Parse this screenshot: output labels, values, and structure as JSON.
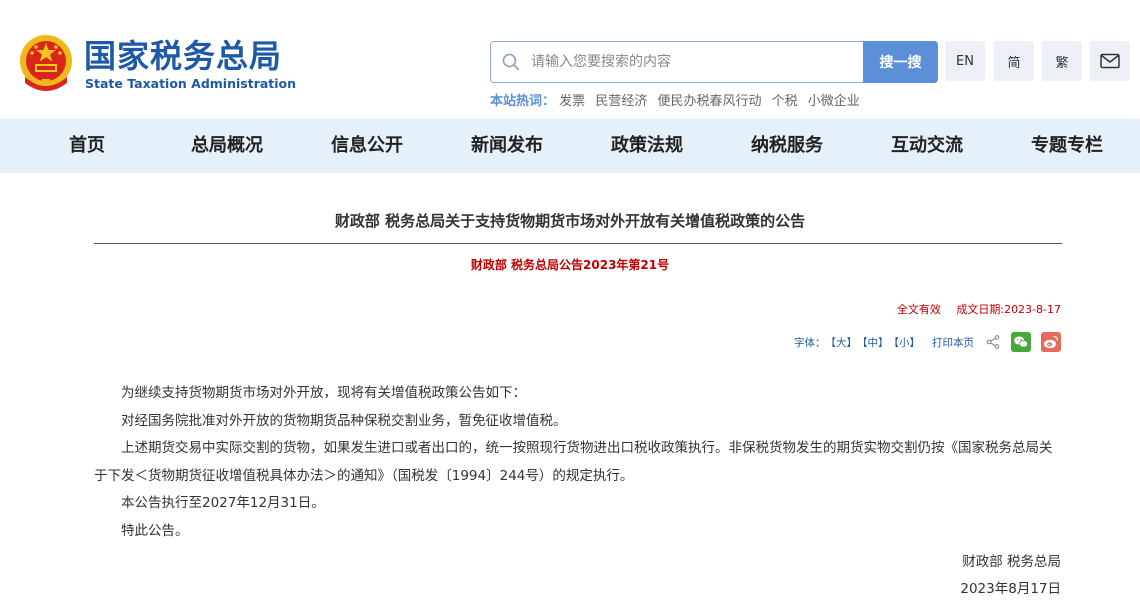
{
  "header": {
    "logo_cn": "国家税务总局",
    "logo_en": "State Taxation Administration",
    "search_placeholder": "请输入您要搜索的内容",
    "search_button": "搜一搜",
    "lang_en": "EN",
    "lang_simplified": "简",
    "lang_traditional": "繁",
    "hot_label": "本站热词：",
    "hot_words": [
      "发票",
      "民营经济",
      "便民办税春风行动",
      "个税",
      "小微企业"
    ]
  },
  "nav": [
    "首页",
    "总局概况",
    "信息公开",
    "新闻发布",
    "政策法规",
    "纳税服务",
    "互动交流",
    "专题专栏"
  ],
  "article": {
    "title": "财政部 税务总局关于支持货物期货市场对外开放有关增值税政策的公告",
    "doc_number": "财政部 税务总局公告2023年第21号",
    "validity": "全文有效",
    "date_label": "成文日期:2023-8-17",
    "font_label": "字体：",
    "font_large": "【大】",
    "font_medium": "【中】",
    "font_small": "【小】",
    "print_label": "打印本页",
    "paragraphs": [
      "为继续支持货物期货市场对外开放，现将有关增值税政策公告如下：",
      "对经国务院批准对外开放的货物期货品种保税交割业务，暂免征收增值税。",
      "上述期货交易中实际交割的货物，如果发生进口或者出口的，统一按照现行货物进出口税收政策执行。非保税货物发生的期货实物交割仍按《国家税务总局关于下发＜货物期货征收增值税具体办法＞的通知》（国税发〔1994〕244号）的规定执行。",
      "本公告执行至2027年12月31日。",
      "特此公告。"
    ],
    "signature": "财政部  税务总局",
    "sign_date": "2023年8月17日"
  },
  "colors": {
    "brand_blue": "#1d59a6",
    "accent_red": "#c00000",
    "nav_bg": "#e6f0fb",
    "search_button_bg": "#5b8fd8"
  }
}
